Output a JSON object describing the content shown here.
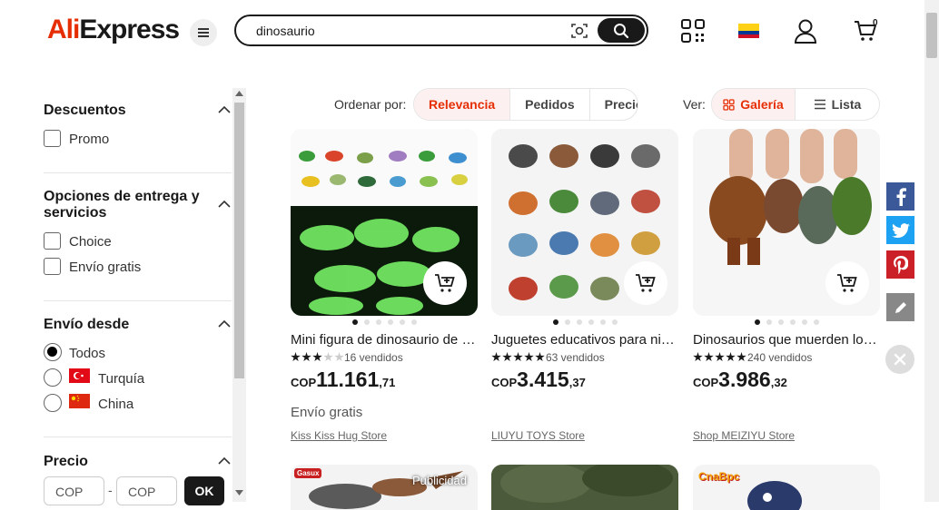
{
  "header": {
    "logo_text_a": "Ali",
    "logo_text_b": "Express",
    "search_value": "dinosaurio",
    "cart_count": "0",
    "icons": [
      "menu-icon",
      "camera-icon",
      "search-icon",
      "qr-code-icon",
      "colombia-flag-icon",
      "user-icon",
      "cart-icon"
    ]
  },
  "filters": {
    "descuentos": {
      "title": "Descuentos",
      "options": [
        "Promo"
      ]
    },
    "entrega": {
      "title_line1": "Opciones de entrega y",
      "title_line2": "servicios",
      "options": [
        "Choice",
        "Envío gratis"
      ]
    },
    "envio_desde": {
      "title": "Envío desde",
      "options": [
        "Todos",
        "Turquía",
        "China"
      ],
      "selected": "Todos"
    },
    "precio": {
      "title": "Precio",
      "min_placeholder": "COP",
      "max_placeholder": "COP",
      "ok_label": "OK"
    }
  },
  "sortbar": {
    "label": "Ordenar por:",
    "options": [
      "Relevancia",
      "Pedidos",
      "Precio"
    ],
    "selected": "Relevancia",
    "view_label": "Ver:",
    "views": [
      "Galería",
      "Lista"
    ],
    "selected_view": "Galería"
  },
  "products": [
    {
      "title": "Mini figura de dinosaurio de g...",
      "rating": 3,
      "sold": "16 vendidos",
      "currency": "COP",
      "price_int": "11.161",
      "price_dec": ",71",
      "shipping": "Envío gratis",
      "store": "Kiss Kiss Hug Store"
    },
    {
      "title": "Juguetes educativos para niño...",
      "rating": 5,
      "sold": "63 vendidos",
      "currency": "COP",
      "price_int": "3.415",
      "price_dec": ",37",
      "shipping": "",
      "store": "LIUYU TOYS Store"
    },
    {
      "title": "Dinosaurios que muerden los...",
      "rating": 5,
      "sold": "240 vendidos",
      "currency": "COP",
      "price_int": "3.986",
      "price_dec": ",32",
      "shipping": "",
      "store": "Shop MEIZIYU Store"
    }
  ],
  "row2": {
    "ad_label": "Publicidad",
    "brand_a": "Gasux",
    "brand_b": "CnaBpc"
  },
  "colors": {
    "accent": "#e62e04",
    "facebook": "#3b5998",
    "twitter": "#1da1f2",
    "pinterest": "#cb2027",
    "edit": "#888888"
  }
}
